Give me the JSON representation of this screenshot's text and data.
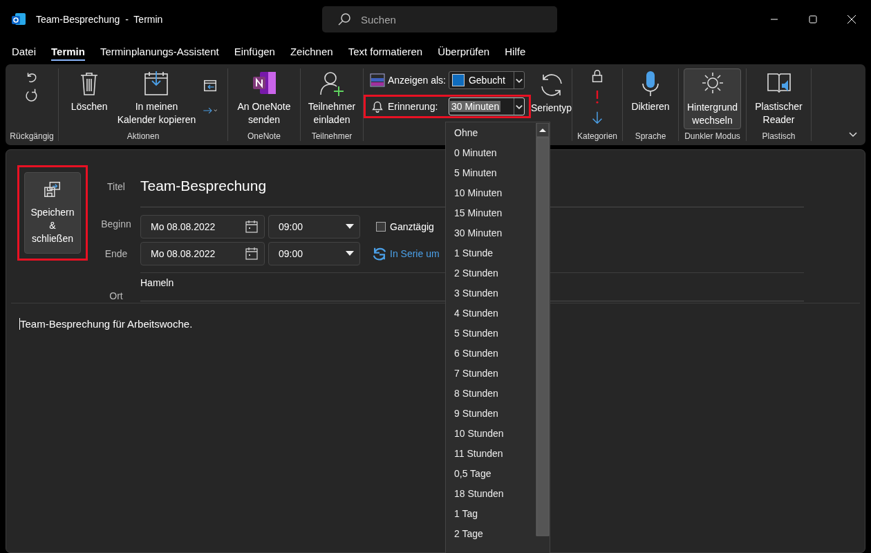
{
  "window": {
    "title": "Team-Besprechung  -  Termin",
    "search_placeholder": "Suchen"
  },
  "menu_tabs": [
    {
      "label": "Datei",
      "selected": false
    },
    {
      "label": "Termin",
      "selected": true
    },
    {
      "label": "Terminplanungs-Assistent",
      "selected": false
    },
    {
      "label": "Einfügen",
      "selected": false
    },
    {
      "label": "Zeichnen",
      "selected": false
    },
    {
      "label": "Text formatieren",
      "selected": false
    },
    {
      "label": "Überprüfen",
      "selected": false
    },
    {
      "label": "Hilfe",
      "selected": false
    }
  ],
  "ribbon": {
    "undo": {
      "label": "Rückgängig"
    },
    "actions": {
      "label": "Aktionen",
      "delete": "Löschen",
      "copy": [
        "In meinen",
        "Kalender kopieren"
      ]
    },
    "onenote": {
      "label": "OneNote",
      "send": [
        "An OneNote",
        "senden"
      ]
    },
    "attendees": {
      "label": "Teilnehmer",
      "invite": [
        "Teilnehmer",
        "einladen"
      ]
    },
    "options": {
      "show_as_label": "Anzeigen als:",
      "show_as": {
        "value": "Gebucht",
        "color": "#0f6cbd"
      },
      "reminder_label": "Erinnerung:",
      "reminder": "30 Minuten",
      "reminder_highlighted": true,
      "recurrence": "Serientyp"
    },
    "tags": {
      "label": "Kategorien"
    },
    "voice": {
      "label": "Sprache",
      "dictate": "Diktieren"
    },
    "dark": {
      "label": "Dunkler Modus",
      "switch": [
        "Hintergrund",
        "wechseln"
      ],
      "on": true
    },
    "reader": {
      "label": "Plastisch",
      "button": [
        "Plastischer",
        "Reader"
      ]
    }
  },
  "form": {
    "save": {
      "lines": [
        "Speichern",
        "&",
        "schließen"
      ],
      "highlighted": true
    },
    "title_label": "Titel",
    "title": "Team-Besprechung",
    "start_label": "Beginn",
    "start_date": "Mo 08.08.2022",
    "start_time": "09:00",
    "end_label": "Ende",
    "end_date": "Mo 08.08.2022",
    "end_time": "09:00",
    "all_day": {
      "label": "Ganztägig",
      "checked": false
    },
    "recurrence_link": "In Serie um",
    "location_label": "Ort",
    "location": "Hameln",
    "body": "Team-Besprechung für Arbeitswoche."
  },
  "reminder_dropdown": [
    {
      "label": "Ohne",
      "selected": false
    },
    {
      "label": "0 Minuten",
      "selected": false
    },
    {
      "label": "5 Minuten",
      "selected": false
    },
    {
      "label": "10 Minuten",
      "selected": false
    },
    {
      "label": "15 Minuten",
      "selected": false
    },
    {
      "label": "30 Minuten",
      "selected": false
    },
    {
      "label": "1 Stunde",
      "selected": false
    },
    {
      "label": "2 Stunden",
      "selected": false
    },
    {
      "label": "3 Stunden",
      "selected": false
    },
    {
      "label": "4 Stunden",
      "selected": false
    },
    {
      "label": "5 Stunden",
      "selected": false
    },
    {
      "label": "6 Stunden",
      "selected": false
    },
    {
      "label": "7 Stunden",
      "selected": false
    },
    {
      "label": "8 Stunden",
      "selected": false
    },
    {
      "label": "9 Stunden",
      "selected": false
    },
    {
      "label": "10 Stunden",
      "selected": false
    },
    {
      "label": "11 Stunden",
      "selected": false
    },
    {
      "label": "0,5 Tage",
      "selected": false
    },
    {
      "label": "18 Stunden",
      "selected": false
    },
    {
      "label": "1 Tag",
      "selected": false
    },
    {
      "label": "2 Tage",
      "selected": false
    }
  ]
}
